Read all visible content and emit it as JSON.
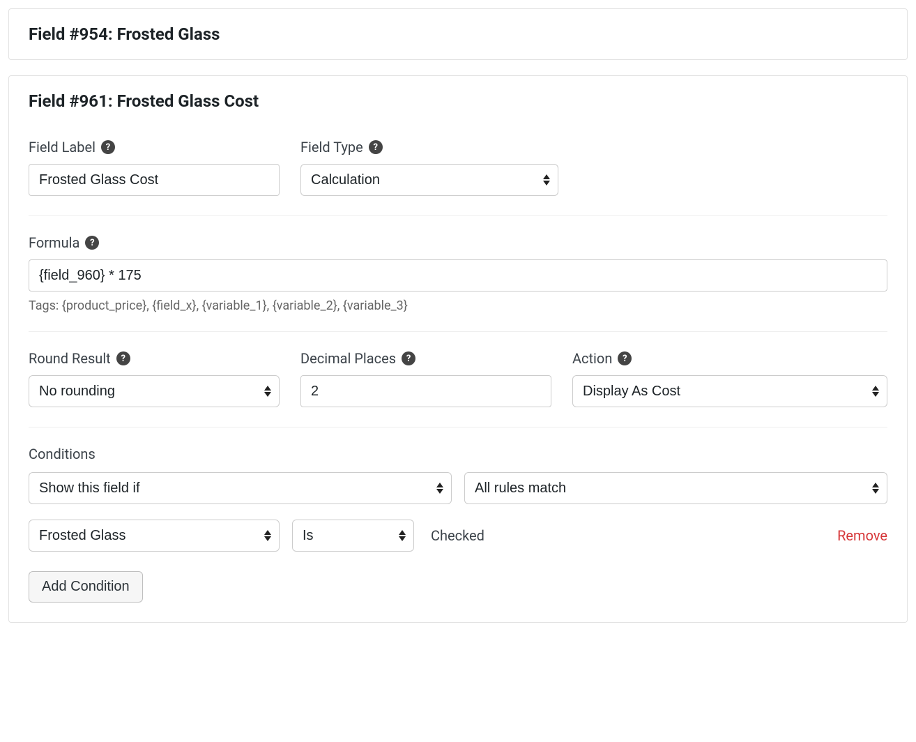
{
  "field954": {
    "title": "Field #954: Frosted Glass"
  },
  "field961": {
    "title": "Field #961: Frosted Glass Cost",
    "fieldLabel": {
      "label": "Field Label",
      "value": "Frosted Glass Cost"
    },
    "fieldType": {
      "label": "Field Type",
      "value": "Calculation"
    },
    "formula": {
      "label": "Formula",
      "value": "{field_960} * 175",
      "tags": "Tags: {product_price}, {field_x}, {variable_1}, {variable_2}, {variable_3}"
    },
    "roundResult": {
      "label": "Round Result",
      "value": "No rounding"
    },
    "decimalPlaces": {
      "label": "Decimal Places",
      "value": "2"
    },
    "action": {
      "label": "Action",
      "value": "Display As Cost"
    },
    "conditions": {
      "label": "Conditions",
      "showIf": "Show this field if",
      "match": "All rules match",
      "rule": {
        "field": "Frosted Glass",
        "operator": "Is",
        "value": "Checked"
      },
      "removeLabel": "Remove",
      "addButton": "Add Condition"
    }
  }
}
